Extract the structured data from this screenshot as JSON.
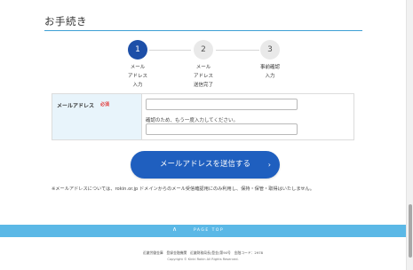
{
  "heading": "お手続き",
  "steps": [
    {
      "number": "1",
      "label": "メール\nアドレス\n入力"
    },
    {
      "number": "2",
      "label": "メール\nアドレス\n送信完了"
    },
    {
      "number": "3",
      "label": "事前確認\n入力"
    }
  ],
  "form": {
    "field_label": "メールアドレス",
    "required_badge": "必須",
    "email_value": "",
    "confirm_hint": "確認のため、もう一度入力してください。",
    "confirm_value": ""
  },
  "submit_label": "メールアドレスを送信する",
  "submit_arrow": "›",
  "notice": "※メールアドレスについては、rokin.or.jp ドメインからのメール受信確認用にのみ利用し、保持・保管・取得はいたしません。",
  "pagetop": {
    "chevron": "∧",
    "label": "PAGE TOP"
  },
  "footer": {
    "links": "近畿労働金庫　登録金融機関　近畿財務局長(登金)第90号　金融コード：2978",
    "copyright": "Copyright © Kinki Rokin All Rights Reserved."
  },
  "colors": {
    "accent": "#1f5fbf",
    "step_active": "#1d4fa8",
    "band": "#5bb8e6",
    "rule": "#3da0d5",
    "required": "#e23a3a"
  }
}
